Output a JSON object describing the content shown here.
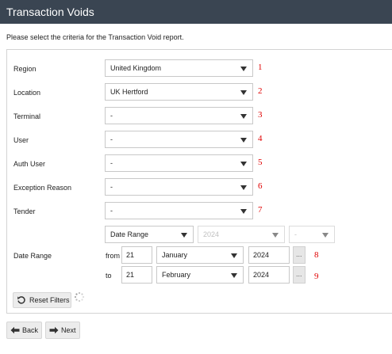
{
  "header": {
    "title": "Transaction Voids"
  },
  "intro": "Please select the criteria for the Transaction Void report.",
  "filters": [
    {
      "label": "Region",
      "value": "United Kingdom",
      "marker": "1"
    },
    {
      "label": "Location",
      "value": "UK Hertford",
      "marker": "2"
    },
    {
      "label": "Terminal",
      "value": "-",
      "marker": "3"
    },
    {
      "label": "User",
      "value": "-",
      "marker": "4"
    },
    {
      "label": "Auth User",
      "value": "-",
      "marker": "5"
    },
    {
      "label": "Exception Reason",
      "value": "-",
      "marker": "6"
    },
    {
      "label": "Tender",
      "value": "-",
      "marker": "7"
    }
  ],
  "date_range": {
    "label": "Date Range",
    "mode": "Date Range",
    "year_select": "2024",
    "extra_select": "-",
    "from": {
      "label": "from",
      "day": "21",
      "month": "January",
      "year": "2024",
      "marker": "8"
    },
    "to": {
      "label": "to",
      "day": "21",
      "month": "February",
      "year": "2024",
      "marker": "9"
    },
    "picker_label": "..."
  },
  "actions": {
    "reset": "Reset Filters",
    "back": "Back",
    "next": "Next"
  },
  "icons": {
    "reset": "undo-icon",
    "loading": "spinner-icon",
    "back": "arrow-left-icon",
    "next": "arrow-right-icon",
    "dropdown": "chevron-down-icon"
  },
  "colors": {
    "header_bg": "#3a4552",
    "marker": "#e00000"
  }
}
